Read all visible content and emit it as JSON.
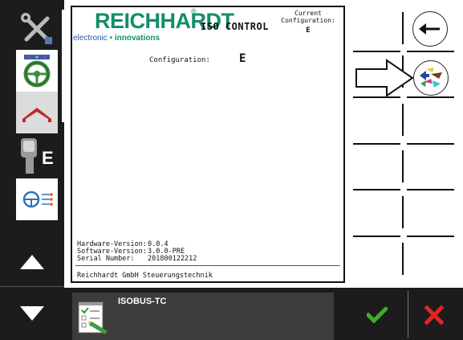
{
  "sidebar": {
    "items": [
      {
        "name": "settings-tools",
        "icon": "wrench-screwdriver-icon"
      },
      {
        "name": "steering-wheel",
        "icon": "steering-wheel-icon"
      },
      {
        "name": "sprayer-boom",
        "icon": "boom-icon"
      },
      {
        "name": "joystick-e",
        "icon": "joystick-icon",
        "label": "E"
      },
      {
        "name": "steering-config",
        "icon": "steering-config-icon"
      }
    ],
    "nav_up_icon": "triangle-up-icon",
    "nav_down_icon": "triangle-down-icon"
  },
  "brand": {
    "name": "REICHHARDT",
    "registered_mark": "®",
    "tagline_part1": "electronic",
    "tagline_dot": "•",
    "tagline_part2": "innovations"
  },
  "main": {
    "title": "ISO CONTROL",
    "current_config_label_line1": "Current",
    "current_config_label_line2": "Configuration:",
    "current_config_value": "E",
    "configuration_label": "Configuration:",
    "configuration_value": "E",
    "hardware_label": "Hardware-Version:",
    "hardware_value": "0.0.4",
    "software_label": "Software-Version:",
    "software_value": "3.0.0-PRE",
    "serial_label": "Serial Number:",
    "serial_value": "201800122212",
    "footer": "Reichhardt GmbH Steuerungstechnik"
  },
  "softkeys": {
    "back_icon": "arrow-left-icon",
    "config_icon": "color-arrows-config-icon",
    "pointer_icon": "pointer-arrow-icon"
  },
  "taskbar": {
    "task_label": "ISOBUS-TC",
    "task_icon": "checklist-pen-icon",
    "confirm_icon": "check-icon",
    "cancel_icon": "x-icon"
  },
  "colors": {
    "brand_green": "#128e6a",
    "brand_blue": "#2a5aa8",
    "sidebar_bg": "#1c1c1c",
    "confirm_green": "#3fae29",
    "cancel_red": "#e32424"
  }
}
